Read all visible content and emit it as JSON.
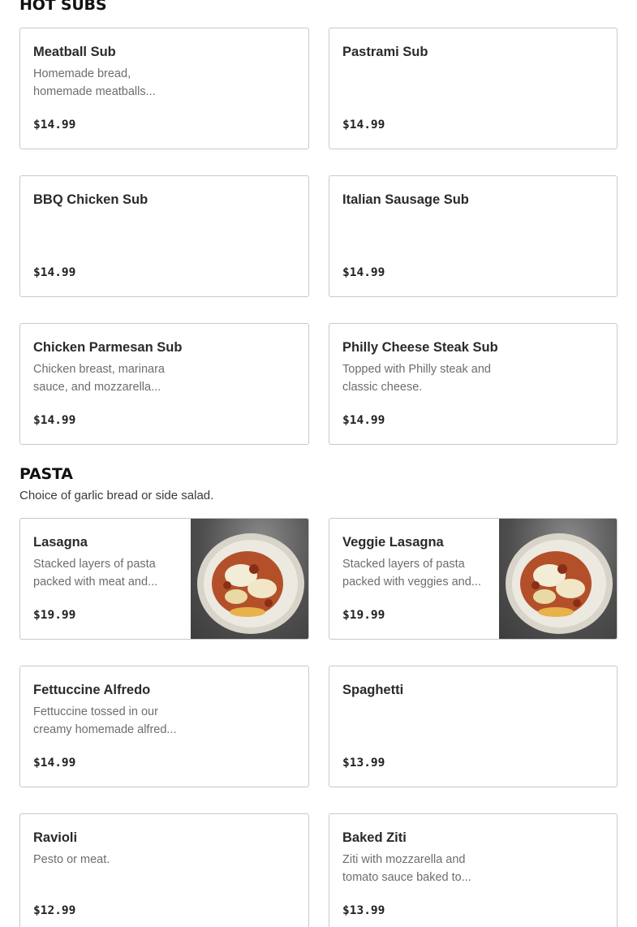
{
  "sections": [
    {
      "title": "HOT SUBS",
      "description": "",
      "items": [
        {
          "name": "Meatball Sub",
          "desc": "Homemade bread, homemade meatballs...",
          "price": "$14.99",
          "image": false
        },
        {
          "name": "Pastrami Sub",
          "desc": "",
          "price": "$14.99",
          "image": false
        },
        {
          "name": "BBQ Chicken Sub",
          "desc": "",
          "price": "$14.99",
          "image": false
        },
        {
          "name": "Italian Sausage Sub",
          "desc": "",
          "price": "$14.99",
          "image": false
        },
        {
          "name": "Chicken Parmesan Sub",
          "desc": "Chicken breast, marinara sauce, and mozzarella...",
          "price": "$14.99",
          "image": false
        },
        {
          "name": "Philly Cheese Steak Sub",
          "desc": "Topped with Philly steak and classic cheese.",
          "price": "$14.99",
          "image": false
        }
      ]
    },
    {
      "title": "PASTA",
      "description": "Choice of garlic bread or side salad.",
      "items": [
        {
          "name": "Lasagna",
          "desc": "Stacked layers of pasta packed with meat and...",
          "price": "$19.99",
          "image": true
        },
        {
          "name": "Veggie Lasagna",
          "desc": "Stacked layers of pasta packed with veggies and...",
          "price": "$19.99",
          "image": true
        },
        {
          "name": "Fettuccine Alfredo",
          "desc": "Fettuccine tossed in our creamy homemade alfred...",
          "price": "$14.99",
          "image": false
        },
        {
          "name": "Spaghetti",
          "desc": "",
          "price": "$13.99",
          "image": false
        },
        {
          "name": "Ravioli",
          "desc": "Pesto or meat.",
          "price": "$12.99",
          "image": false
        },
        {
          "name": "Baked Ziti",
          "desc": "Ziti with mozzarella and tomato sauce baked to...",
          "price": "$13.99",
          "image": false
        }
      ]
    }
  ]
}
